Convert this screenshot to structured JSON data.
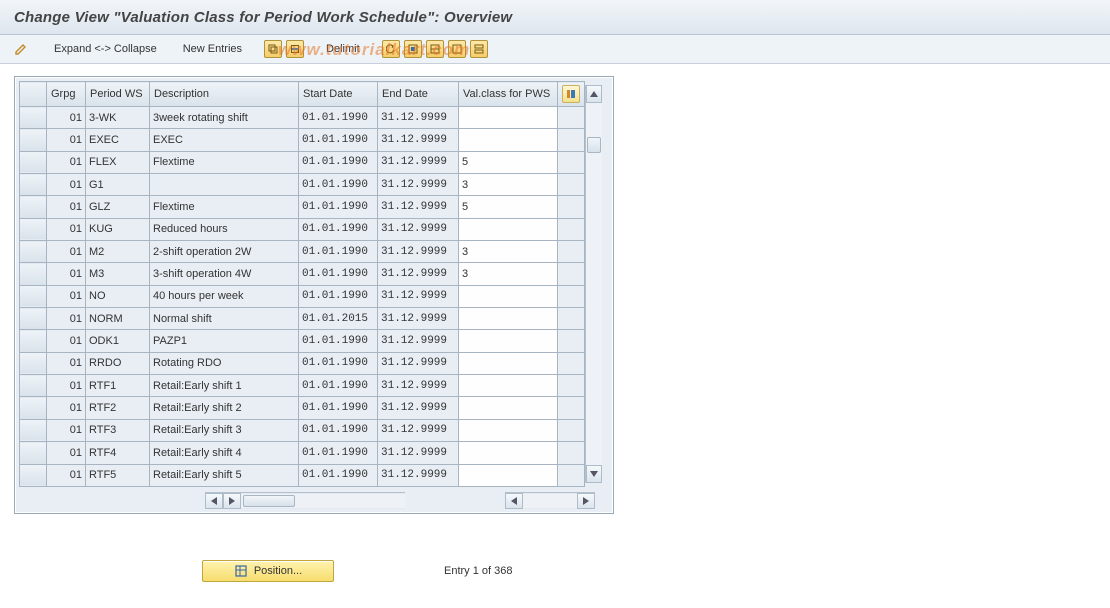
{
  "title": "Change View \"Valuation Class for Period Work Schedule\": Overview",
  "toolbar": {
    "expand_collapse": "Expand <-> Collapse",
    "new_entries": "New Entries",
    "delimit": "Delimit"
  },
  "watermark": "www.tutorialkart.com",
  "table": {
    "headers": {
      "grpg": "Grpg",
      "period_ws": "Period WS",
      "description": "Description",
      "start_date": "Start Date",
      "end_date": "End Date",
      "val_class": "Val.class for PWS"
    },
    "rows": [
      {
        "grpg": "01",
        "pws": "3-WK",
        "desc": "3week rotating shift",
        "sd": "01.01.1990",
        "ed": "31.12.9999",
        "vc": ""
      },
      {
        "grpg": "01",
        "pws": "EXEC",
        "desc": "EXEC",
        "sd": "01.01.1990",
        "ed": "31.12.9999",
        "vc": ""
      },
      {
        "grpg": "01",
        "pws": "FLEX",
        "desc": "Flextime",
        "sd": "01.01.1990",
        "ed": "31.12.9999",
        "vc": "5"
      },
      {
        "grpg": "01",
        "pws": "G1",
        "desc": "",
        "sd": "01.01.1990",
        "ed": "31.12.9999",
        "vc": "3"
      },
      {
        "grpg": "01",
        "pws": "GLZ",
        "desc": "Flextime",
        "sd": "01.01.1990",
        "ed": "31.12.9999",
        "vc": "5"
      },
      {
        "grpg": "01",
        "pws": "KUG",
        "desc": "Reduced hours",
        "sd": "01.01.1990",
        "ed": "31.12.9999",
        "vc": ""
      },
      {
        "grpg": "01",
        "pws": "M2",
        "desc": "2-shift operation 2W",
        "sd": "01.01.1990",
        "ed": "31.12.9999",
        "vc": "3"
      },
      {
        "grpg": "01",
        "pws": "M3",
        "desc": "3-shift operation 4W",
        "sd": "01.01.1990",
        "ed": "31.12.9999",
        "vc": "3"
      },
      {
        "grpg": "01",
        "pws": "NO",
        "desc": "40 hours per week",
        "sd": "01.01.1990",
        "ed": "31.12.9999",
        "vc": ""
      },
      {
        "grpg": "01",
        "pws": "NORM",
        "desc": "Normal shift",
        "sd": "01.01.2015",
        "ed": "31.12.9999",
        "vc": ""
      },
      {
        "grpg": "01",
        "pws": "ODK1",
        "desc": "PAZP1",
        "sd": "01.01.1990",
        "ed": "31.12.9999",
        "vc": ""
      },
      {
        "grpg": "01",
        "pws": "RRDO",
        "desc": "Rotating RDO",
        "sd": "01.01.1990",
        "ed": "31.12.9999",
        "vc": ""
      },
      {
        "grpg": "01",
        "pws": "RTF1",
        "desc": "Retail:Early shift 1",
        "sd": "01.01.1990",
        "ed": "31.12.9999",
        "vc": ""
      },
      {
        "grpg": "01",
        "pws": "RTF2",
        "desc": "Retail:Early shift 2",
        "sd": "01.01.1990",
        "ed": "31.12.9999",
        "vc": ""
      },
      {
        "grpg": "01",
        "pws": "RTF3",
        "desc": "Retail:Early shift 3",
        "sd": "01.01.1990",
        "ed": "31.12.9999",
        "vc": ""
      },
      {
        "grpg": "01",
        "pws": "RTF4",
        "desc": "Retail:Early shift 4",
        "sd": "01.01.1990",
        "ed": "31.12.9999",
        "vc": ""
      },
      {
        "grpg": "01",
        "pws": "RTF5",
        "desc": "Retail:Early shift 5",
        "sd": "01.01.1990",
        "ed": "31.12.9999",
        "vc": ""
      }
    ]
  },
  "footer": {
    "position_button": "Position...",
    "entry_info": "Entry 1 of 368"
  }
}
